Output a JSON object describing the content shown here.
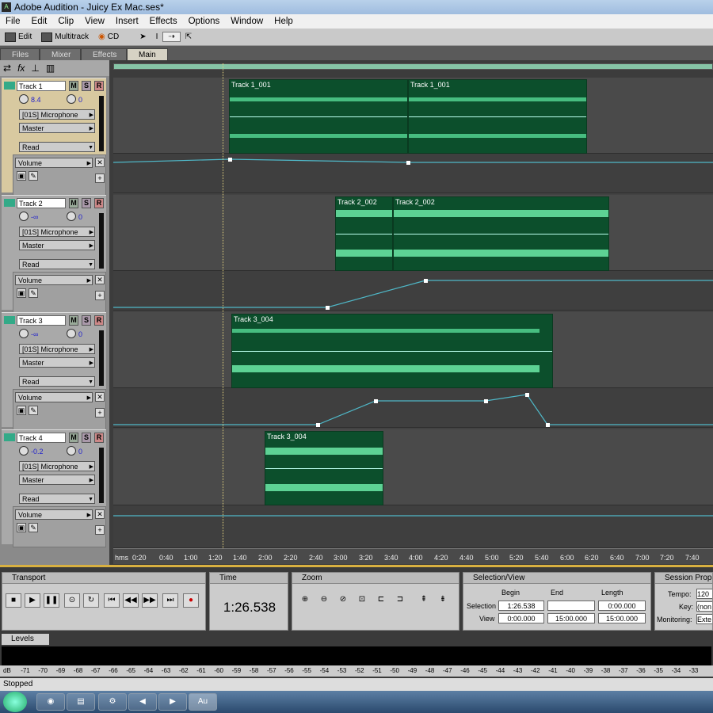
{
  "window": {
    "title": "Adobe Audition - Juicy Ex Mac.ses*"
  },
  "menu": [
    "File",
    "Edit",
    "Clip",
    "View",
    "Insert",
    "Effects",
    "Options",
    "Window",
    "Help"
  ],
  "toolbar": {
    "edit_label": "Edit",
    "multitrack_label": "Multitrack",
    "cd_label": "CD"
  },
  "tabs": [
    "Files",
    "Mixer",
    "Effects",
    "Main"
  ],
  "tracks": [
    {
      "name": "Track 1",
      "volume": "8.4",
      "pan": "0",
      "input": "[01S] Microphone",
      "output": "Master",
      "mode": "Read",
      "automation": "Volume"
    },
    {
      "name": "Track 2",
      "volume": "-∞",
      "pan": "0",
      "input": "[01S] Microphone",
      "output": "Master",
      "mode": "Read",
      "automation": "Volume"
    },
    {
      "name": "Track 3",
      "volume": "-∞",
      "pan": "0",
      "input": "[01S] Microphone",
      "output": "Master",
      "mode": "Read",
      "automation": "Volume"
    },
    {
      "name": "Track 4",
      "volume": "-0.2",
      "pan": "0",
      "input": "[01S] Microphone",
      "output": "Master",
      "mode": "Read",
      "automation": "Volume"
    }
  ],
  "msr": {
    "m": "M",
    "s": "S",
    "r": "R"
  },
  "clips": {
    "c1a": "Track 1_001",
    "c1b": "Track 1_001",
    "c2a": "Track 2_002",
    "c2b": "Track 2_002",
    "c3": "Track 3_004",
    "c4": "Track 3_004"
  },
  "ruler": [
    "hms",
    "0:20",
    "0:40",
    "1:00",
    "1:20",
    "1:40",
    "2:00",
    "2:20",
    "2:40",
    "3:00",
    "3:20",
    "3:40",
    "4:00",
    "4:20",
    "4:40",
    "5:00",
    "5:20",
    "5:40",
    "6:00",
    "6:20",
    "6:40",
    "7:00",
    "7:20",
    "7:40"
  ],
  "panels": {
    "transport": "Transport",
    "time": "Time",
    "zoom": "Zoom",
    "selection": "Selection/View",
    "session": "Session Proper",
    "time_value": "1:26.538",
    "sel_begin_h": "Begin",
    "sel_end_h": "End",
    "sel_length_h": "Length",
    "sel_row": "Selection",
    "view_row": "View",
    "sel_begin": "1:26.538",
    "sel_end": "",
    "sel_length": "0:00.000",
    "view_begin": "0:00.000",
    "view_end": "15:00.000",
    "view_length": "15:00.000",
    "tempo_label": "Tempo:",
    "tempo": "120",
    "key_label": "Key:",
    "key": "(non",
    "monitoring_label": "Monitoring:",
    "monitoring": "Exte"
  },
  "levels": {
    "tab": "Levels",
    "scale": [
      "dB",
      "-71",
      "-70",
      "-69",
      "-68",
      "-67",
      "-66",
      "-65",
      "-64",
      "-63",
      "-62",
      "-61",
      "-60",
      "-59",
      "-58",
      "-57",
      "-56",
      "-55",
      "-54",
      "-53",
      "-52",
      "-51",
      "-50",
      "-49",
      "-48",
      "-47",
      "-46",
      "-45",
      "-44",
      "-43",
      "-42",
      "-41",
      "-40",
      "-39",
      "-38",
      "-37",
      "-36",
      "-35",
      "-34",
      "-33"
    ]
  },
  "status": "Stopped",
  "taskbar": {
    "au": "Au"
  }
}
